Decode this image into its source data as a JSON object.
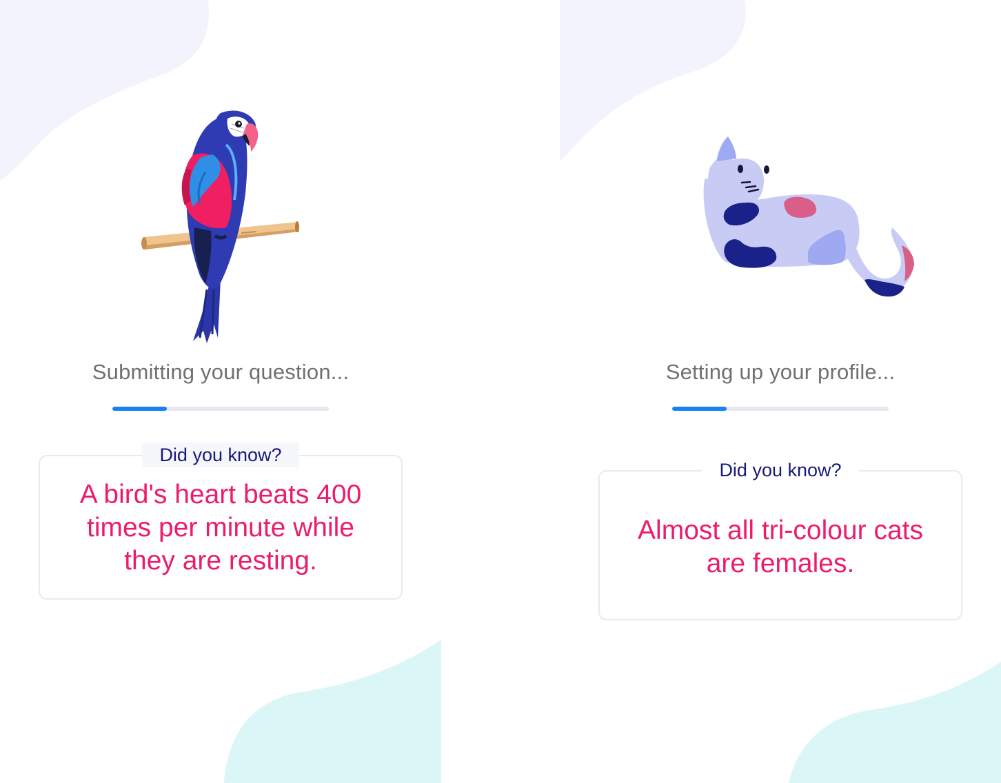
{
  "colors": {
    "accent_blue": "#1681f2",
    "fact_pink": "#ec1c6b",
    "heading_navy": "#161a7a",
    "status_gray": "#707070",
    "blob_lavender": "#f3f3fd",
    "blob_aqua": "#dbf6f7"
  },
  "screens": [
    {
      "illustration": "parrot-illustration",
      "status_text": "Submitting your question...",
      "progress": 0.25,
      "fact_heading": "Did you know?",
      "fact_lines": [
        "A bird's heart beats 400",
        "times per minute while",
        "they are resting."
      ]
    },
    {
      "illustration": "cat-illustration",
      "status_text": "Setting up your profile...",
      "progress": 0.25,
      "fact_heading": "Did you know?",
      "fact_lines": [
        "Almost all tri-colour cats",
        "are females."
      ]
    }
  ]
}
